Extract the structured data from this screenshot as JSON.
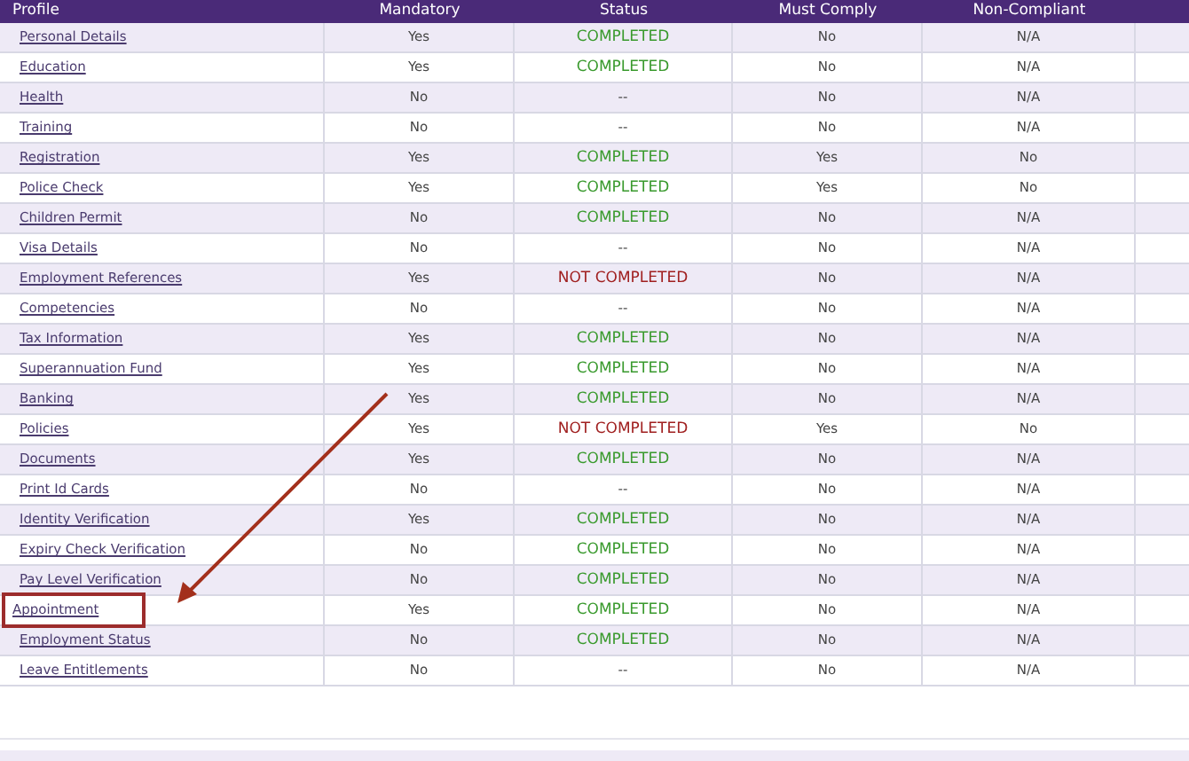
{
  "table": {
    "columns": [
      "Profile",
      "Mandatory",
      "Status",
      "Must Comply",
      "Non-Compliant"
    ],
    "rows": [
      {
        "profile": "Personal Details",
        "mandatory": "Yes",
        "status": "COMPLETED",
        "kind": "completed",
        "must_comply": "No",
        "non_compliant": "N/A",
        "highlighted": false
      },
      {
        "profile": "Education",
        "mandatory": "Yes",
        "status": "COMPLETED",
        "kind": "completed",
        "must_comply": "No",
        "non_compliant": "N/A",
        "highlighted": false
      },
      {
        "profile": "Health",
        "mandatory": "No",
        "status": "--",
        "kind": "none",
        "must_comply": "No",
        "non_compliant": "N/A",
        "highlighted": false
      },
      {
        "profile": "Training",
        "mandatory": "No",
        "status": "--",
        "kind": "none",
        "must_comply": "No",
        "non_compliant": "N/A",
        "highlighted": false
      },
      {
        "profile": "Registration",
        "mandatory": "Yes",
        "status": "COMPLETED",
        "kind": "completed",
        "must_comply": "Yes",
        "non_compliant": "No",
        "highlighted": false
      },
      {
        "profile": "Police Check",
        "mandatory": "Yes",
        "status": "COMPLETED",
        "kind": "completed",
        "must_comply": "Yes",
        "non_compliant": "No",
        "highlighted": false
      },
      {
        "profile": "Children Permit",
        "mandatory": "No",
        "status": "COMPLETED",
        "kind": "completed",
        "must_comply": "No",
        "non_compliant": "N/A",
        "highlighted": false
      },
      {
        "profile": "Visa Details",
        "mandatory": "No",
        "status": "--",
        "kind": "none",
        "must_comply": "No",
        "non_compliant": "N/A",
        "highlighted": false
      },
      {
        "profile": "Employment References",
        "mandatory": "Yes",
        "status": "NOT COMPLETED",
        "kind": "not_completed",
        "must_comply": "No",
        "non_compliant": "N/A",
        "highlighted": false
      },
      {
        "profile": "Competencies",
        "mandatory": "No",
        "status": "--",
        "kind": "none",
        "must_comply": "No",
        "non_compliant": "N/A",
        "highlighted": false
      },
      {
        "profile": "Tax Information",
        "mandatory": "Yes",
        "status": "COMPLETED",
        "kind": "completed",
        "must_comply": "No",
        "non_compliant": "N/A",
        "highlighted": false
      },
      {
        "profile": "Superannuation Fund",
        "mandatory": "Yes",
        "status": "COMPLETED",
        "kind": "completed",
        "must_comply": "No",
        "non_compliant": "N/A",
        "highlighted": false
      },
      {
        "profile": "Banking",
        "mandatory": "Yes",
        "status": "COMPLETED",
        "kind": "completed",
        "must_comply": "No",
        "non_compliant": "N/A",
        "highlighted": false
      },
      {
        "profile": "Policies",
        "mandatory": "Yes",
        "status": "NOT COMPLETED",
        "kind": "not_completed",
        "must_comply": "Yes",
        "non_compliant": "No",
        "highlighted": false
      },
      {
        "profile": "Documents",
        "mandatory": "Yes",
        "status": "COMPLETED",
        "kind": "completed",
        "must_comply": "No",
        "non_compliant": "N/A",
        "highlighted": false
      },
      {
        "profile": "Print Id Cards",
        "mandatory": "No",
        "status": "--",
        "kind": "none",
        "must_comply": "No",
        "non_compliant": "N/A",
        "highlighted": false
      },
      {
        "profile": "Identity Verification",
        "mandatory": "Yes",
        "status": "COMPLETED",
        "kind": "completed",
        "must_comply": "No",
        "non_compliant": "N/A",
        "highlighted": false
      },
      {
        "profile": "Expiry Check Verification",
        "mandatory": "No",
        "status": "COMPLETED",
        "kind": "completed",
        "must_comply": "No",
        "non_compliant": "N/A",
        "highlighted": false
      },
      {
        "profile": "Pay Level Verification",
        "mandatory": "No",
        "status": "COMPLETED",
        "kind": "completed",
        "must_comply": "No",
        "non_compliant": "N/A",
        "highlighted": false
      },
      {
        "profile": "Appointment",
        "mandatory": "Yes",
        "status": "COMPLETED",
        "kind": "completed",
        "must_comply": "No",
        "non_compliant": "N/A",
        "highlighted": true
      },
      {
        "profile": "Employment Status",
        "mandatory": "No",
        "status": "COMPLETED",
        "kind": "completed",
        "must_comply": "No",
        "non_compliant": "N/A",
        "highlighted": false
      },
      {
        "profile": "Leave Entitlements",
        "mandatory": "No",
        "status": "--",
        "kind": "none",
        "must_comply": "No",
        "non_compliant": "N/A",
        "highlighted": false
      }
    ]
  }
}
